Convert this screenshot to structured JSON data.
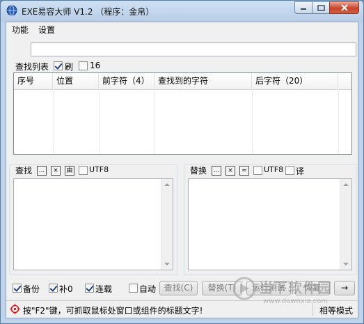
{
  "window": {
    "title": "EXE易容大师 V1.2 （程序：金帛）"
  },
  "menu": {
    "items": [
      "功能",
      "设置"
    ]
  },
  "top_input": {
    "value": ""
  },
  "find_list": {
    "label": "查找列表",
    "check_refresh": {
      "label": "刷",
      "checked": true
    },
    "check_16": {
      "label": "16",
      "checked": false
    },
    "columns": [
      "序号",
      "位置",
      "前字符（4）",
      "查找到的字符",
      "后字符（20）"
    ],
    "rows": []
  },
  "find_panel": {
    "label": "查找",
    "tool_buttons": [
      "...",
      "×",
      "由"
    ],
    "utf8": {
      "label": "UTF8",
      "checked": false
    },
    "text": ""
  },
  "replace_panel": {
    "label": "替换",
    "tool_buttons": [
      "...",
      "×",
      "≈"
    ],
    "utf8": {
      "label": "UTF8",
      "checked": false
    },
    "translate": {
      "label": "译",
      "checked": false
    },
    "text": ""
  },
  "options": {
    "backup": {
      "label": "备份",
      "checked": true
    },
    "pad_zero": {
      "label": "补0",
      "checked": true
    },
    "continuous": {
      "label": "连载",
      "checked": true
    },
    "auto": {
      "label": "自动",
      "checked": false
    }
  },
  "buttons": {
    "find": "查找(C)",
    "replace": "替换(T)",
    "run": "运行测试",
    "restore": "恢复",
    "arrow": "→"
  },
  "status": {
    "hint": "按\"F2\"键，可抓取鼠标处窗口或组件的标题文字!",
    "mode": "相等模式"
  },
  "watermark": {
    "site": "当下软件园",
    "url": "www.downxia.com"
  },
  "colors": {
    "titlebar": "#cfe0f3",
    "close_button": "#c7442a",
    "status_icon": "#d01818",
    "checkmark": "#1c3f8f"
  }
}
